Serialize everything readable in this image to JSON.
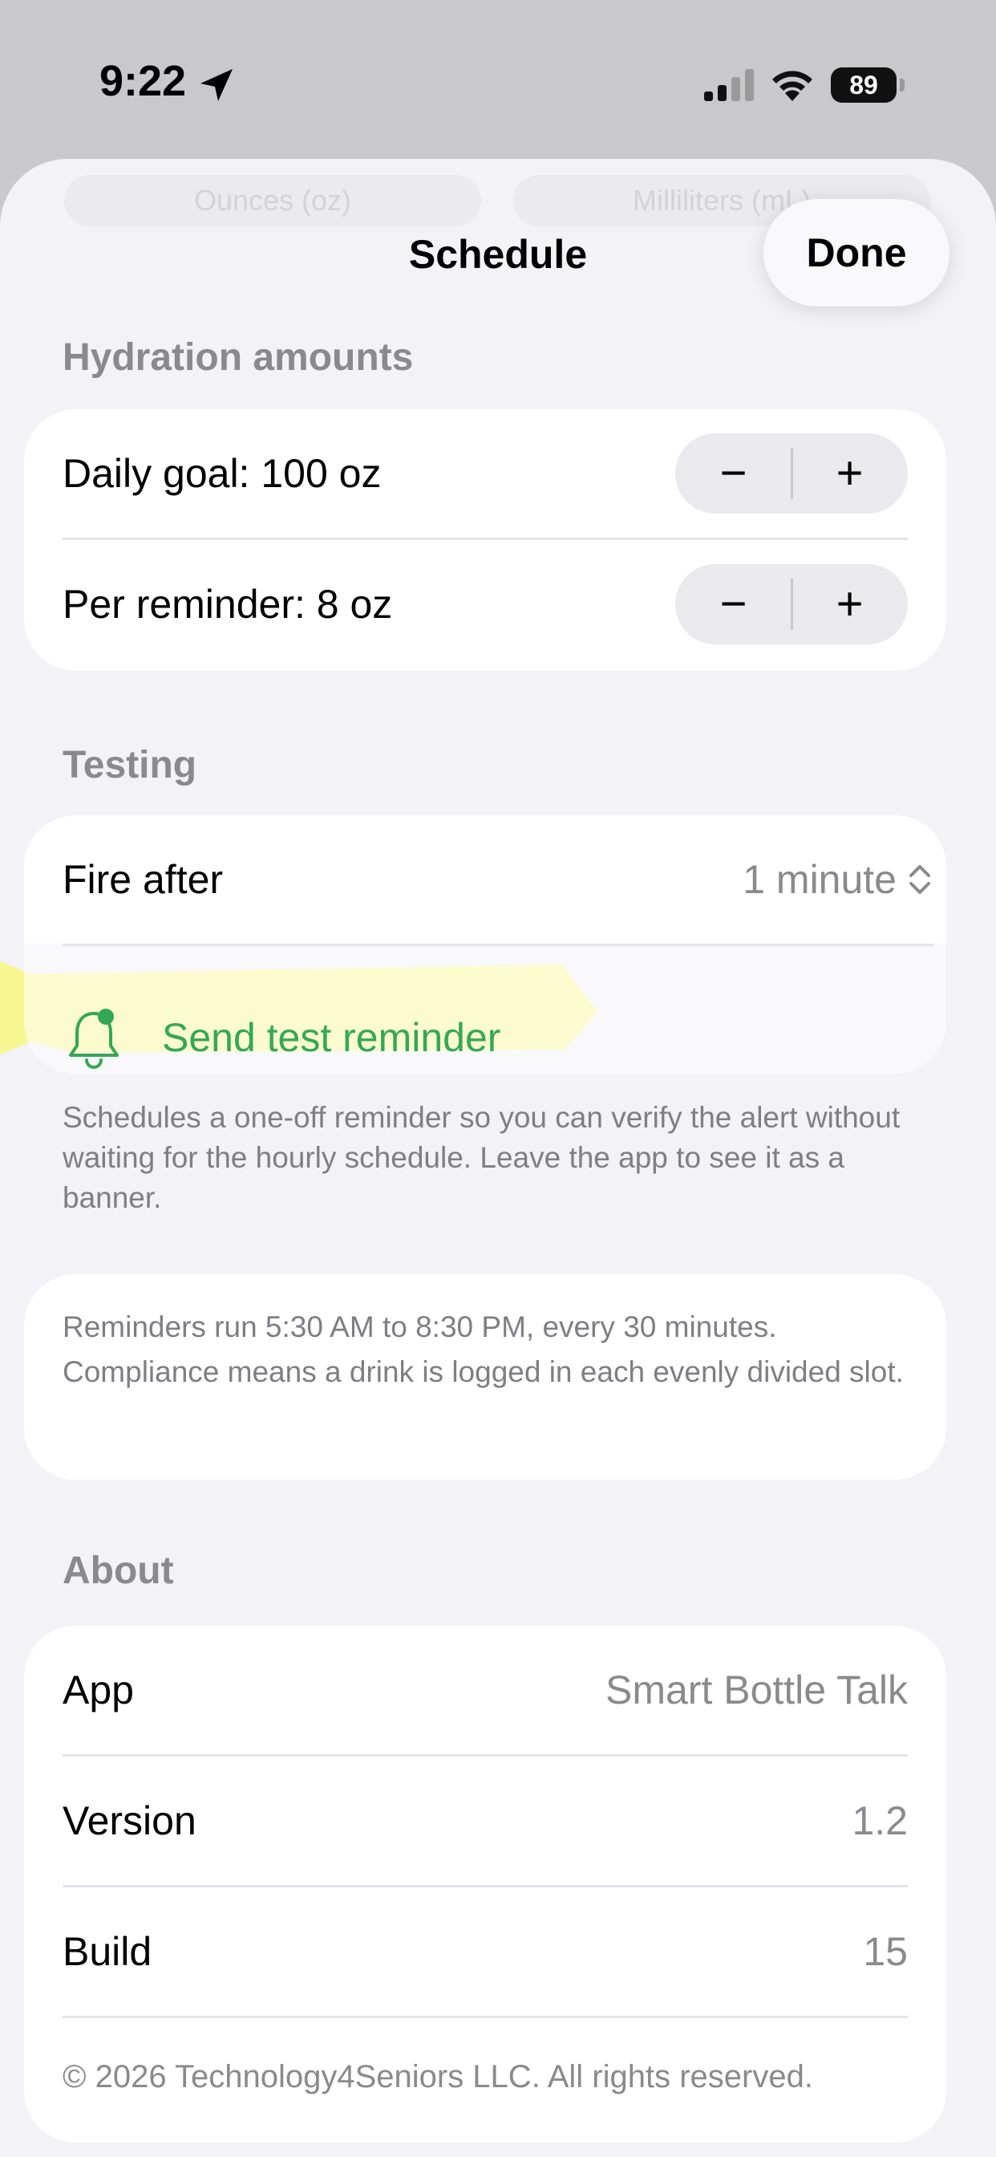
{
  "status": {
    "time": "9:22",
    "battery": "89"
  },
  "sheet": {
    "segments": [
      "Ounces (oz)",
      "Milliliters (mL)"
    ],
    "title": "Schedule",
    "done_label": "Done"
  },
  "hydration": {
    "header": "Hydration amounts",
    "daily_goal": "Daily goal: 100 oz",
    "per_reminder": "Per reminder: 8 oz",
    "minus": "−",
    "plus": "+"
  },
  "testing": {
    "header": "Testing",
    "fire_after_label": "Fire after",
    "fire_after_value": "1 minute",
    "send_test_label": "Send test reminder",
    "footnote": "Schedules a one-off reminder so you can verify the alert without waiting for the hourly schedule. Leave the app to see it as a banner."
  },
  "info": {
    "text": "Reminders run 5:30 AM to 8:30 PM, every 30 minutes. Compliance means a drink is logged in each evenly divided slot."
  },
  "about": {
    "header": "About",
    "rows": [
      {
        "label": "App",
        "value": "Smart Bottle Talk"
      },
      {
        "label": "Version",
        "value": "1.2"
      },
      {
        "label": "Build",
        "value": "15"
      }
    ],
    "copyright": "© 2026 Technology4Seniors LLC. All rights reserved."
  },
  "colors": {
    "accent": "#34a853",
    "highlight": "#f7f58a",
    "background": "#f2f2f7"
  },
  "icons": [
    "location-arrow-icon",
    "cellular-signal-icon",
    "wifi-icon",
    "battery-icon",
    "chevron-up-down-icon",
    "bell-badge-icon"
  ]
}
